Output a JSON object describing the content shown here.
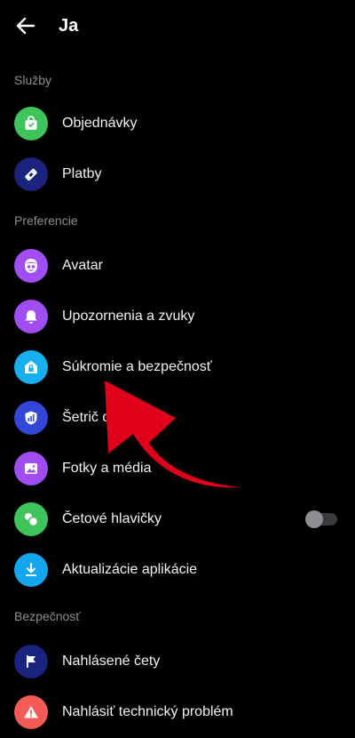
{
  "header": {
    "title": "Ja"
  },
  "sections": {
    "services": {
      "label": "Služby",
      "items": [
        {
          "label": "Objednávky",
          "icon": "shopping-bag-icon",
          "color": "#3ec45a"
        },
        {
          "label": "Platby",
          "icon": "payment-tag-icon",
          "color": "#1a237e"
        }
      ]
    },
    "preferences": {
      "label": "Preferencie",
      "items": [
        {
          "label": "Avatar",
          "icon": "avatar-icon",
          "color": "#a04ef4"
        },
        {
          "label": "Upozornenia a zvuky",
          "icon": "bell-icon",
          "color": "#a04ef4"
        },
        {
          "label": "Súkromie a bezpečnosť",
          "icon": "privacy-home-icon",
          "color": "#16b0f0"
        },
        {
          "label": "Šetrič dát",
          "icon": "data-saver-icon",
          "color": "#3247d8"
        },
        {
          "label": "Fotky a média",
          "icon": "photo-icon",
          "color": "#a04ef4"
        },
        {
          "label": "Četové hlavičky",
          "icon": "chat-heads-icon",
          "color": "#3ec45a",
          "toggle": false
        },
        {
          "label": "Aktualizácie aplikácie",
          "icon": "download-icon",
          "color": "#16a6ef"
        }
      ]
    },
    "security": {
      "label": "Bezpečnosť",
      "items": [
        {
          "label": "Nahlásené čety",
          "icon": "flag-icon",
          "color": "#1a237e"
        },
        {
          "label": "Nahlásiť technický problém",
          "icon": "warning-icon",
          "color": "#f25c54"
        }
      ]
    }
  },
  "overlay": {
    "arrow_color": "#e0001a"
  }
}
